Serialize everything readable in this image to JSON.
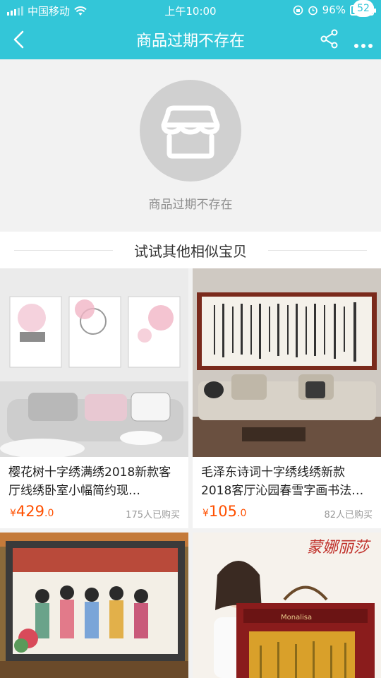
{
  "status_bar": {
    "carrier": "中国移动",
    "time": "上午10:00",
    "battery": "96%",
    "battery_level": 0.96
  },
  "nav": {
    "title": "商品过期不存在",
    "badge_count": "52",
    "icons": [
      "back-arrow-icon",
      "share-icon",
      "more-icon"
    ]
  },
  "empty_state": {
    "icon": "store-icon",
    "message": "商品过期不存在"
  },
  "section": {
    "title": "试试其他相似宝贝"
  },
  "colors": {
    "accent": "#33c6d8",
    "price": "#ff5000",
    "muted": "#999999"
  },
  "products": [
    {
      "name": "樱花树十字绣满绣2018新款客厅线绣卧室小幅简约现…",
      "currency": "¥",
      "price_int": "429",
      "price_dec": ".0",
      "sold": "175人已购买"
    },
    {
      "name": "毛泽东诗词十字绣线绣新款2018客厅沁园春雪字画书法…",
      "currency": "¥",
      "price_int": "105",
      "price_dec": ".0",
      "sold": "82人已购买"
    },
    {
      "name": "",
      "sold": ""
    },
    {
      "name": "",
      "brand_text": "蒙娜丽莎",
      "box_text": "Monalisa",
      "sold": ""
    }
  ]
}
